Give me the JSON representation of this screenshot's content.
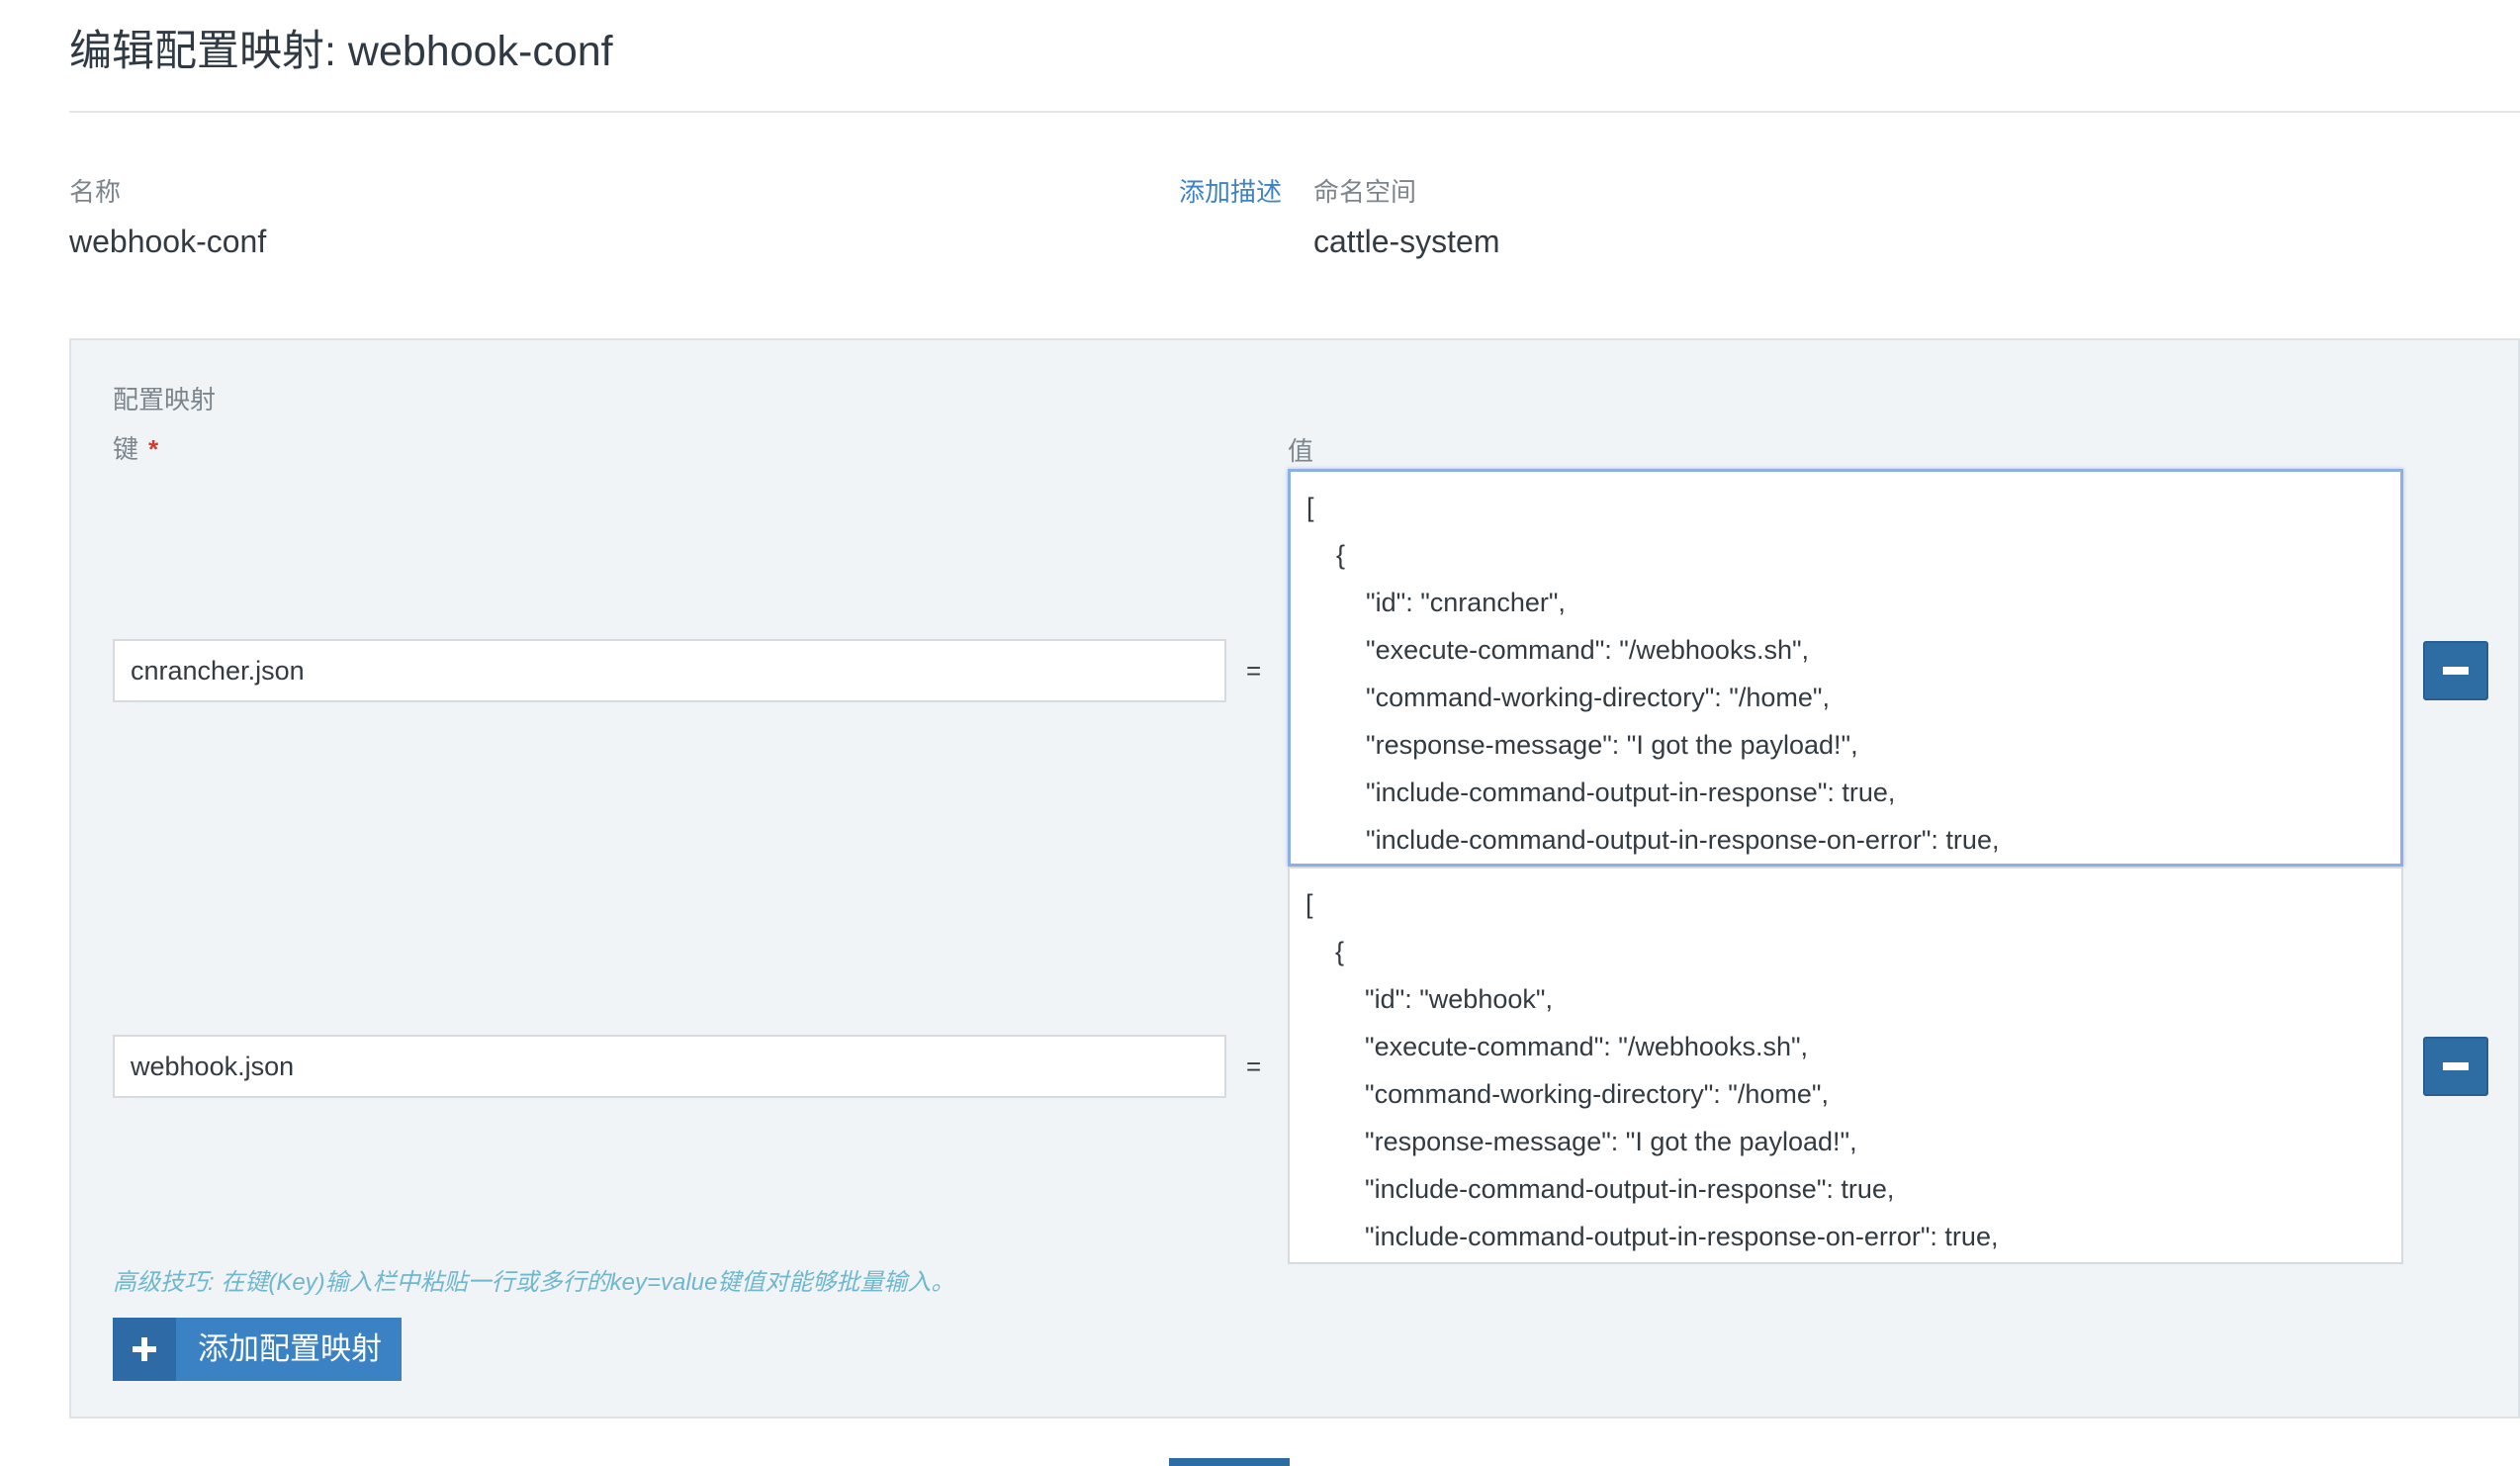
{
  "page": {
    "title": "编辑配置映射: webhook-conf"
  },
  "name_field": {
    "label": "名称",
    "value": "webhook-conf"
  },
  "add_description": {
    "label": "添加描述"
  },
  "namespace_field": {
    "label": "命名空间",
    "value": "cattle-system"
  },
  "config_panel": {
    "heading": "配置映射",
    "key_label": "键",
    "required_mark": "*",
    "value_label": "值",
    "equals_sign": "=",
    "entries": [
      {
        "key": "cnrancher.json",
        "value_lines": [
          "[",
          "    {",
          "        \"id\": \"cnrancher\",",
          "        \"execute-command\": \"/webhooks.sh\",",
          "        \"command-working-directory\": \"/home\",",
          "        \"response-message\": \"I got the payload!\",",
          "        \"include-command-output-in-response\": true,",
          "        \"include-command-output-in-response-on-error\": true,"
        ],
        "focused": true
      },
      {
        "key": "webhook.json",
        "value_lines": [
          "[",
          "    {",
          "        \"id\": \"webhook\",",
          "        \"execute-command\": \"/webhooks.sh\",",
          "        \"command-working-directory\": \"/home\",",
          "        \"response-message\": \"I got the payload!\",",
          "        \"include-command-output-in-response\": true,",
          "        \"include-command-output-in-response-on-error\": true,"
        ],
        "focused": false
      }
    ],
    "tip": "高级技巧: 在键(Key)输入栏中粘贴一行或多行的key=value键值对能够批量输入。",
    "add_button_label": "添加配置映射"
  },
  "colors": {
    "accent": "#3b82c4",
    "accent_dark": "#2e6da4",
    "panel_bg": "#f1f4f6",
    "focus_border": "#8eaee8",
    "tip": "#6fb7cf",
    "required": "#d33a2c"
  },
  "icons": {
    "remove": "minus-icon",
    "add": "plus-icon"
  }
}
